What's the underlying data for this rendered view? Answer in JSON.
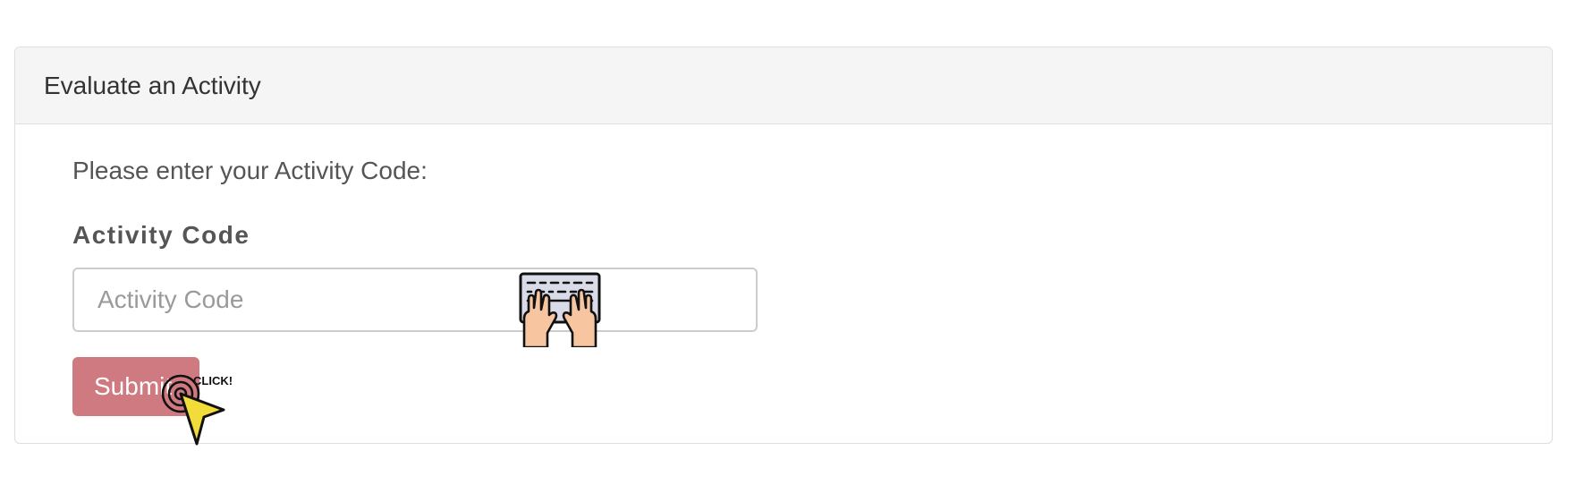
{
  "panel": {
    "title": "Evaluate an Activity"
  },
  "form": {
    "instructions": "Please enter your Activity Code:",
    "code_label": "Activity Code",
    "code_placeholder": "Activity Code",
    "code_value": "",
    "submit_label": "Submit"
  },
  "overlays": {
    "keyboard_icon": "typing-keyboard-icon",
    "cursor_icon": "click-cursor-icon",
    "cursor_text": "CLICK!"
  },
  "colors": {
    "heading_bg": "#f5f5f5",
    "submit_bg": "#cf7a80",
    "border": "#dedede"
  }
}
